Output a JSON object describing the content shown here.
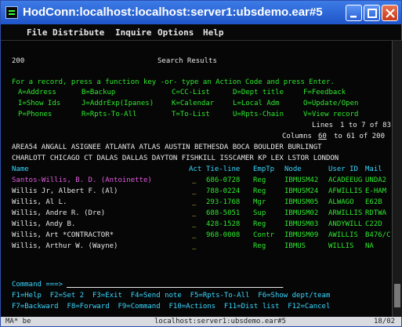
{
  "window": {
    "title": "HodConn:localhost:localhost:server1:ubsdemo.ear#5"
  },
  "menu": [
    "File",
    "Distribute",
    "Inquire",
    "Options",
    "Help"
  ],
  "screen": {
    "id": "200",
    "heading": "Search Results",
    "help_line": "For a record, press a function key -or- type an Action Code and press Enter.",
    "action_codes": [
      [
        "A=Address",
        "B=Backup",
        "C=CC-List",
        "D=Dept title",
        "F=Feedback"
      ],
      [
        "I=Show Ids",
        "J=AddrExp(Ipanes)",
        "K=Calendar",
        "L=Local Adm",
        "O=Update/Open"
      ],
      [
        "P=Phones",
        "R=Rpts-To-All",
        "T=To-List",
        "U=Rpts-Chain",
        "V=View record"
      ]
    ],
    "lines_label": "Lines",
    "lines_value": "1 to 7 of 83",
    "columns_label": "Columns",
    "columns_value": "60",
    "columns_suffix": "to 61 of 200",
    "areas_line1": "AREA54 ANGALL ASIGNEE ATLANTA ATLAS AUSTIN BETHESDA BOCA BOULDER BURLINGT",
    "areas_line2": "CHARLOTT CHICAGO CT DALAS DALLAS DAYTON FISHKILL ISSCAMER KP LEX LSTOR LONDON",
    "columns": {
      "name": "Name",
      "act": "Act",
      "tie": "Tie-line",
      "emp": "EmpTp",
      "node": "Node",
      "user_id": "User ID",
      "mail": "Mail"
    },
    "rows": [
      {
        "name": "Santos-Willis, B. D. (Antoinette)",
        "act": "_",
        "tie": "686-0728",
        "emp": "Reg",
        "node": "IBMUSM42",
        "user_id": "ACADEEUG",
        "mail": "UNDA2"
      },
      {
        "name": "Willis Jr, Albert F. (Al)",
        "act": "_",
        "tie": "788-0224",
        "emp": "Reg",
        "node": "IBMUSM24",
        "user_id": "AFWILLIS",
        "mail": "E-HAM"
      },
      {
        "name": "Willis, Al L.",
        "act": "_",
        "tie": "293-1768",
        "emp": "Mgr",
        "node": "IBMUSM05",
        "user_id": "ALWAGO",
        "mail": "E62B"
      },
      {
        "name": "Willis, Andre R. (Dre)",
        "act": "_",
        "tie": "688-5051",
        "emp": "Sup",
        "node": "IBMUSM02",
        "user_id": "ARWILLIS",
        "mail": "RDTWA"
      },
      {
        "name": "Willis, Andy B.",
        "act": "_",
        "tie": "428-1528",
        "emp": "Reg",
        "node": "IBMUSM03",
        "user_id": "ANDYWILL",
        "mail": "C22D"
      },
      {
        "name": "Willis, Art *CONTRACTOR*",
        "act": "_",
        "tie": "968-0008",
        "emp": "Contr",
        "node": "IBMUSM09",
        "user_id": "AWILLIS",
        "mail": "B476/C"
      },
      {
        "name": "Willis, Arthur W. (Wayne)",
        "act": "_",
        "tie": "",
        "emp": "Reg",
        "node": "IBMUS",
        "user_id": "WILLIS",
        "mail": "NA"
      }
    ],
    "command_label": "Command ===>",
    "fkeys_line1": "F1=Help  F2=Set 2  F3=Exit  F4=Send note  F5=Rpts-To-All  F6=Show dept/team",
    "fkeys_line2": "F7=Backward  F8=Forward  F9=Command  F10=Actions  F11=Dist list  F12=Cancel"
  },
  "status": {
    "left": "MA*  be",
    "center": "localhost:server1:ubsdemo.ear#5",
    "right": "18/02"
  },
  "colors": {
    "titlebar": "#2a62d6",
    "terminal_bg": "#060606",
    "green": "#2ee82e",
    "cyan": "#38d8ff",
    "magenta": "#e25be0"
  }
}
